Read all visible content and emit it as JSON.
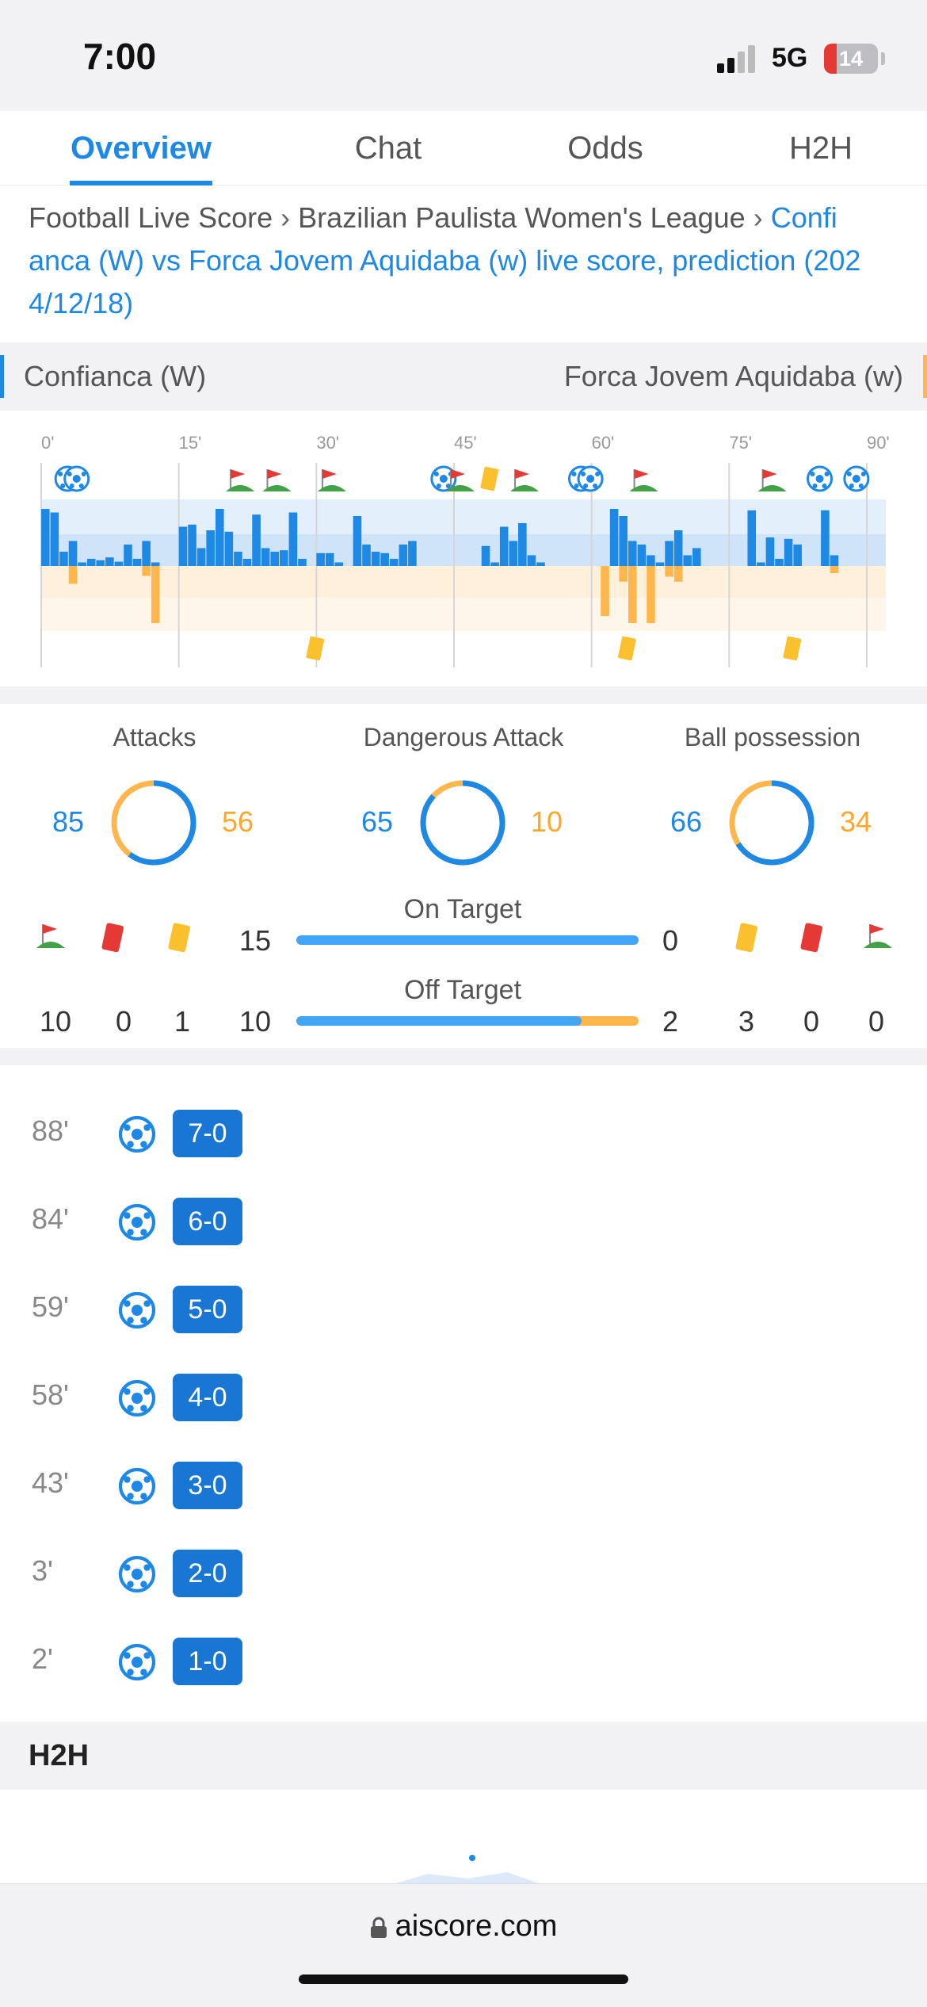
{
  "status_bar": {
    "time": "7:00",
    "network": "5G",
    "battery": "14"
  },
  "tabs": [
    {
      "label": "Overview",
      "active": true
    },
    {
      "label": "Chat",
      "active": false
    },
    {
      "label": "Odds",
      "active": false
    },
    {
      "label": "H2H",
      "active": false
    }
  ],
  "breadcrumb": {
    "home": "Football Live Score",
    "league": "Brazilian Paulista Women's League",
    "current_line1": "Confi",
    "current_line2": "anca (W) vs Forca Jovem Aquidaba (w) live score, prediction (202",
    "current_line3": "4/12/18)"
  },
  "teams": {
    "home": "Confianca (W)",
    "away": "Forca Jovem Aquidaba (w)"
  },
  "timeline": {
    "minute_labels": [
      "0'",
      "15'",
      "30'",
      "45'",
      "60'",
      "75'",
      "90'"
    ],
    "home_goals_minutes": [
      2,
      3,
      43,
      58,
      59,
      84,
      88
    ],
    "home_corner_minutes": [
      21,
      25,
      31,
      45,
      52,
      65,
      79
    ],
    "home_yellow_card_minutes": [
      48
    ],
    "away_yellow_card_minutes": [
      29,
      63,
      81
    ],
    "colors": {
      "home": "#1e88e5",
      "away": "#ffb74d"
    }
  },
  "stats": {
    "attacks": {
      "label": "Attacks",
      "home": "85",
      "away": "56"
    },
    "dangerous_attack": {
      "label": "Dangerous Attack",
      "home": "65",
      "away": "10"
    },
    "ball_possession": {
      "label": "Ball possession",
      "home": "66",
      "away": "34"
    }
  },
  "shots": {
    "on_target": {
      "label": "On Target",
      "home": "15",
      "away": "0"
    },
    "off_target": {
      "label": "Off Target",
      "home": "10",
      "away": "2"
    }
  },
  "discipline": {
    "home": {
      "corners": "10",
      "red_cards": "0",
      "yellow_cards": "1"
    },
    "away": {
      "yellow_cards": "3",
      "red_cards": "0",
      "corners": "0"
    }
  },
  "goals": [
    {
      "minute": "88'",
      "score": "7-0"
    },
    {
      "minute": "84'",
      "score": "6-0"
    },
    {
      "minute": "59'",
      "score": "5-0"
    },
    {
      "minute": "58'",
      "score": "4-0"
    },
    {
      "minute": "43'",
      "score": "3-0"
    },
    {
      "minute": "3'",
      "score": "2-0"
    },
    {
      "minute": "2'",
      "score": "1-0"
    }
  ],
  "h2h": {
    "title": "H2H"
  },
  "browser": {
    "url": "aiscore.com"
  }
}
